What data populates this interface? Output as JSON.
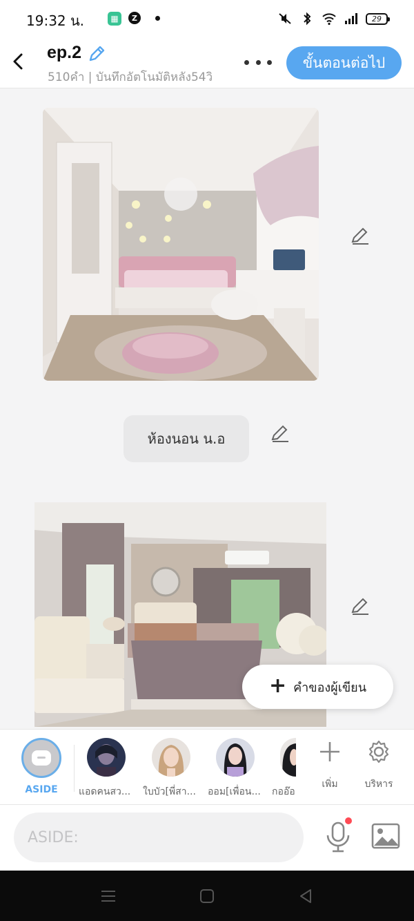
{
  "status_bar": {
    "time": "19:32 น.",
    "battery": "29",
    "app_icon_1": "calendar-app-icon",
    "app_icon_2": "z-app-icon",
    "icons": [
      "mute-icon",
      "bluetooth-icon",
      "wifi-icon",
      "signal-icon",
      "battery-icon"
    ]
  },
  "header": {
    "title": "ep.2",
    "subtitle": "510คำ | บันทึกอัตโนมัติหลัง54วิ",
    "next_button": "ขั้นตอนต่อไป",
    "accent_color": "#58a7f0"
  },
  "feed": {
    "items": [
      {
        "type": "image",
        "depicts": "pink-girls-bedroom-photo"
      },
      {
        "type": "text",
        "text": "ห้องนอน น.อ"
      },
      {
        "type": "image",
        "depicts": "master-bedroom-photo"
      }
    ],
    "add_narration_button": "คำของผู้เขียน"
  },
  "characters": {
    "aside_label": "ASIDE",
    "items": [
      {
        "label": "แอดคนสว..."
      },
      {
        "label": "ใบบัว[พี่สา..."
      },
      {
        "label": "ออม[เพื่อน..."
      },
      {
        "label": "กออ๊อ"
      }
    ],
    "add_label": "เพิ่ม",
    "manage_label": "บริหาร"
  },
  "composer": {
    "placeholder": "ASIDE:",
    "mic_badge_color": "#ff4b55"
  },
  "nav": {
    "icons": [
      "menu-icon",
      "home-icon",
      "back-triangle-icon"
    ]
  }
}
